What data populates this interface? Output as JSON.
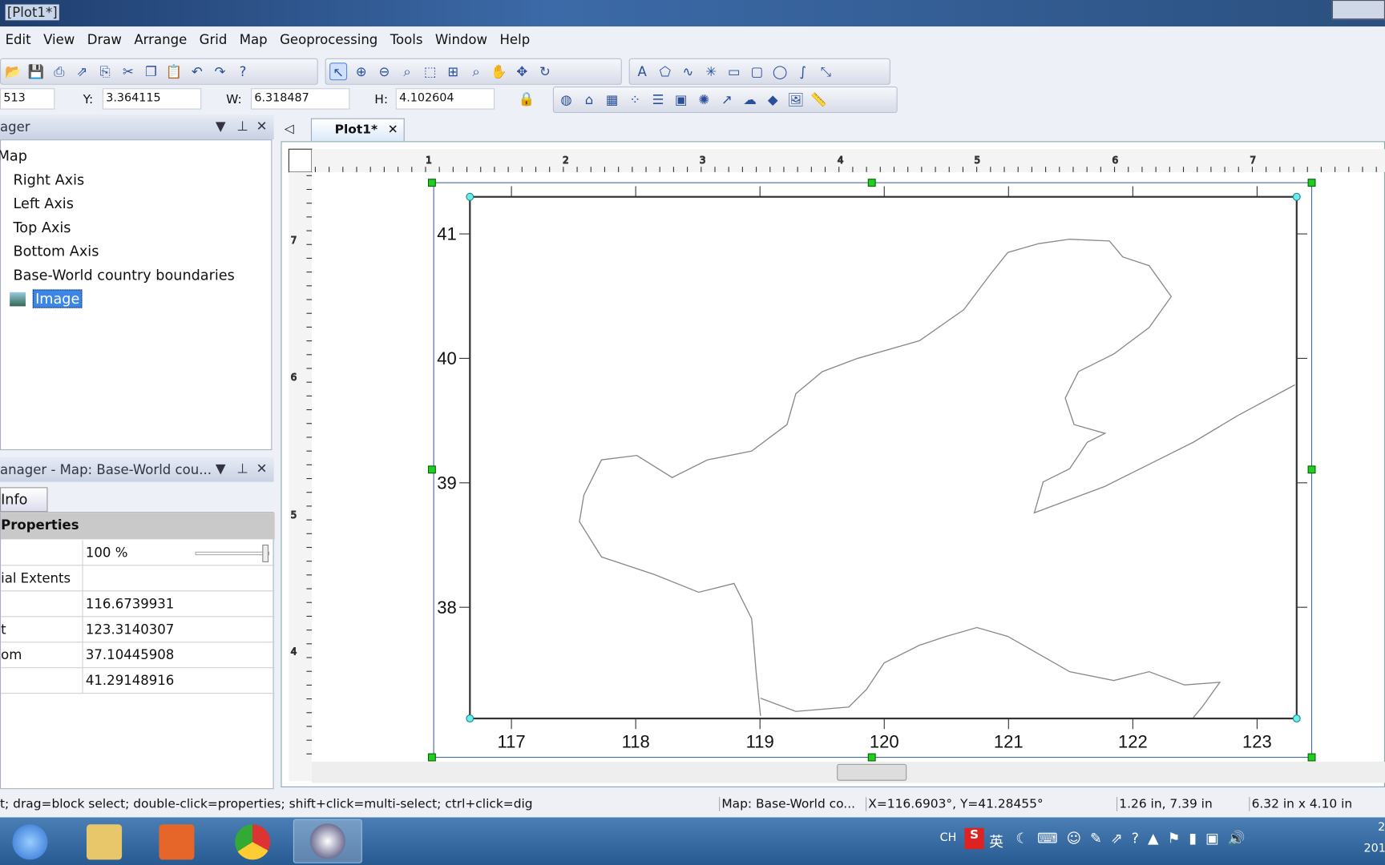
{
  "window": {
    "title": "[Plot1*]"
  },
  "menu": [
    "Edit",
    "View",
    "Draw",
    "Arrange",
    "Grid",
    "Map",
    "Geoprocessing",
    "Tools",
    "Window",
    "Help"
  ],
  "position_bar": {
    "x_value": "513",
    "y_label": "Y:",
    "y_value": "3.364115",
    "w_label": "W:",
    "w_value": "6.318487",
    "h_label": "H:",
    "h_value": "4.102604"
  },
  "object_manager": {
    "title": "ager",
    "items": [
      "Map",
      "Right Axis",
      "Left Axis",
      "Top Axis",
      "Bottom Axis",
      "Base-World country boundaries",
      "Image"
    ],
    "selected": "Image"
  },
  "property_manager": {
    "title": "anager - Map: Base-World cou...",
    "tab": "Info",
    "section": "Properties",
    "rows": [
      {
        "key": "",
        "value": "100 %"
      },
      {
        "key": "ial Extents",
        "value": ""
      },
      {
        "key": "",
        "value": "116.6739931"
      },
      {
        "key": "t",
        "value": "123.3140307"
      },
      {
        "key": "om",
        "value": "37.10445908"
      },
      {
        "key": "",
        "value": "41.29148916"
      }
    ],
    "opacity_percent": 100
  },
  "document": {
    "tab": "Plot1*",
    "ruler_top": [
      "1",
      "2",
      "3",
      "4",
      "5",
      "6",
      "7"
    ],
    "ruler_left": [
      "7",
      "6",
      "5",
      "4"
    ]
  },
  "map": {
    "x_ticks": [
      "117",
      "118",
      "119",
      "120",
      "121",
      "122",
      "123"
    ],
    "y_ticks": [
      "41",
      "40",
      "39",
      "38"
    ],
    "line_color": "#888888"
  },
  "status": {
    "hint": "t; drag=block select; double-click=properties; shift+click=multi-select; ctrl+click=dig",
    "layer": "Map: Base-World co...",
    "coords": "X=116.6903°, Y=41.28455°",
    "position": "1.26 in, 7.39 in",
    "size": "6.32 in x 4.10 in"
  },
  "taskbar": {
    "ime": "CH",
    "ime2": "英",
    "clock_partial": "2",
    "clock_partial2": "201"
  }
}
